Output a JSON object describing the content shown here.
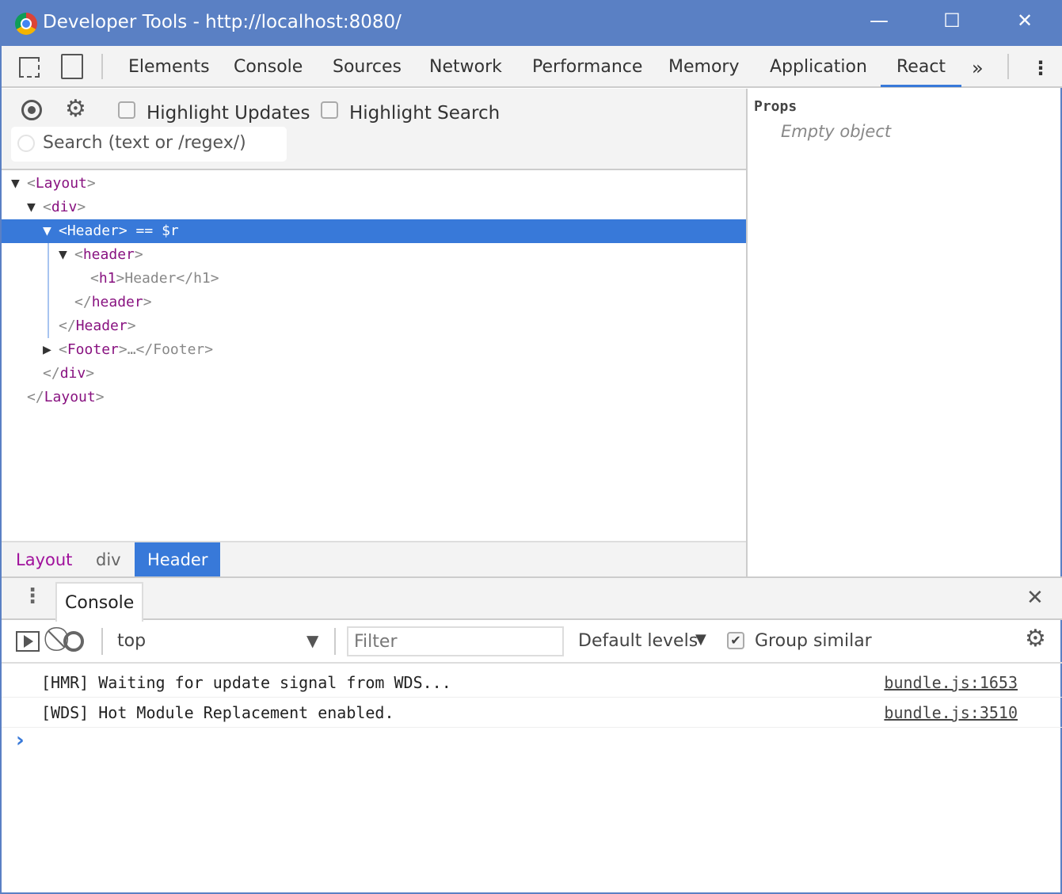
{
  "window": {
    "title": "Developer Tools - http://localhost:8080/"
  },
  "tabs": [
    "Elements",
    "Console",
    "Sources",
    "Network",
    "Performance",
    "Memory",
    "Application",
    "React"
  ],
  "active_tab": "React",
  "react_toolbar": {
    "highlight_updates": "Highlight Updates",
    "highlight_search": "Highlight Search",
    "search_placeholder": "Search (text or /regex/)"
  },
  "tree": [
    {
      "arrow": "▼",
      "open": "<",
      "tag": "Layout",
      "close": ">",
      "rest": ""
    },
    {
      "arrow": "▼",
      "open": "<",
      "tag": "div",
      "close": ">",
      "rest": ""
    },
    {
      "arrow": "▼",
      "open": "<",
      "tag": "Header",
      "close": ">",
      "rest": " == $r"
    },
    {
      "arrow": "▼",
      "open": "<",
      "tag": "header",
      "close": ">",
      "rest": ""
    },
    {
      "arrow": "",
      "open": "<",
      "tag": "h1",
      "close": ">",
      "rest": "Header</h1>"
    },
    {
      "arrow": "",
      "open": "</",
      "tag": "header",
      "close": ">",
      "rest": ""
    },
    {
      "arrow": "",
      "open": "</",
      "tag": "Header",
      "close": ">",
      "rest": ""
    },
    {
      "arrow": "▶",
      "open": "<",
      "tag": "Footer",
      "close": ">",
      "rest": "…</Footer>"
    },
    {
      "arrow": "",
      "open": "</",
      "tag": "div",
      "close": ">",
      "rest": ""
    },
    {
      "arrow": "",
      "open": "</",
      "tag": "Layout",
      "close": ">",
      "rest": ""
    }
  ],
  "breadcrumbs": [
    "Layout",
    "div",
    "Header"
  ],
  "props": {
    "title": "Props",
    "empty": "Empty object"
  },
  "drawer": {
    "tab": "Console",
    "context": "top",
    "filter_placeholder": "Filter",
    "levels": "Default levels",
    "group_similar": "Group similar"
  },
  "messages": [
    {
      "text": "[HMR] Waiting for update signal from WDS...",
      "source": "bundle.js:1653"
    },
    {
      "text": "[WDS] Hot Module Replacement enabled.",
      "source": "bundle.js:3510"
    }
  ],
  "prompt": "›"
}
